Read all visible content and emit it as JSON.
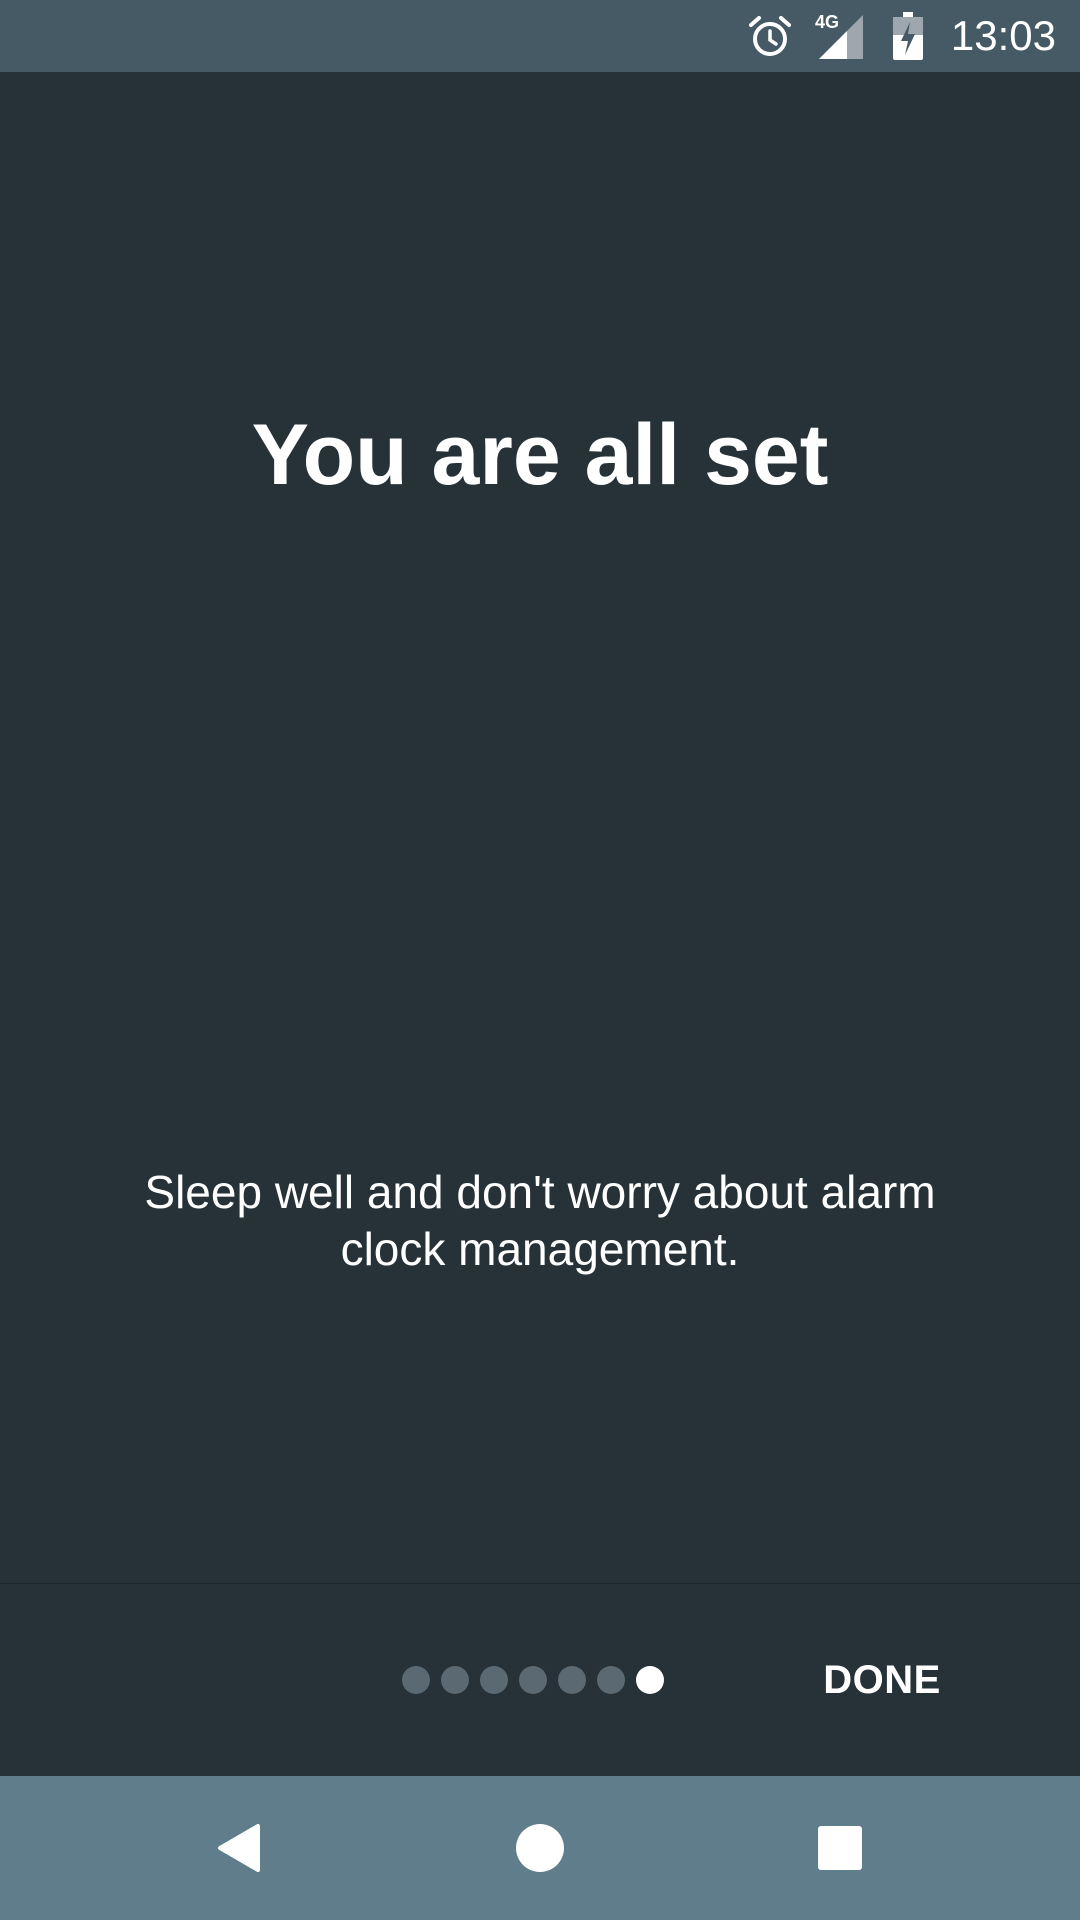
{
  "status_bar": {
    "time": "13:03",
    "network_label": "4G",
    "icons": [
      "alarm-icon",
      "signal-icon",
      "battery-charging-icon"
    ]
  },
  "main": {
    "title": "You are all set",
    "description": "Sleep well and don't worry about alarm clock management."
  },
  "pager": {
    "total_pages": 7,
    "current_page": 7
  },
  "footer": {
    "done_label": "DONE"
  },
  "nav_bar": {
    "icons": [
      "back-icon",
      "home-icon",
      "recents-icon"
    ]
  },
  "colors": {
    "background": "#263238",
    "status_bar": "#455a64",
    "nav_bar": "#607d8b",
    "dot_inactive": "#5b6a72",
    "dot_active": "#ffffff",
    "text": "#ffffff"
  }
}
